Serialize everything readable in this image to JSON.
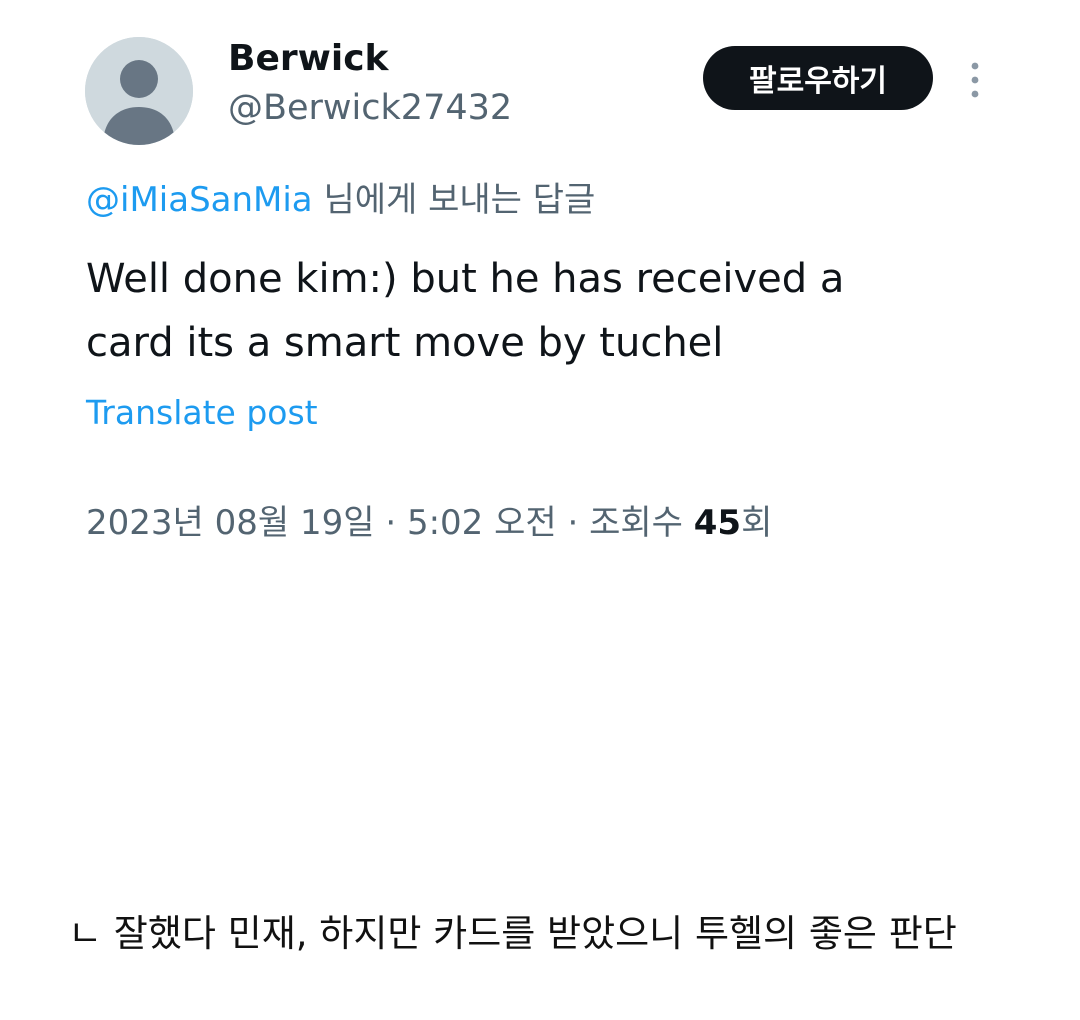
{
  "user": {
    "display_name": "Berwick",
    "handle": "@Berwick27432"
  },
  "follow_button": {
    "label": "팔로우하기"
  },
  "more_menu": {
    "icon": "more-vertical-icon"
  },
  "reply_context": {
    "mention": "@iMiaSanMia",
    "suffix": " 님에게 보내는 답글"
  },
  "tweet": {
    "text_line1": "Well done kim:) but he has received a",
    "text_line2": "card its a smart move by tuchel",
    "translate_label": "Translate post"
  },
  "meta": {
    "date": "2023년 08월 19일",
    "separator": " · ",
    "time": "5:02 오전",
    "views_label": "조회수 ",
    "views_count": "45",
    "views_suffix": "회"
  },
  "caption": {
    "text": "ㄴ 잘했다 민재, 하지만 카드를 받았으니 투헬의 좋은 판단"
  },
  "colors": {
    "accent": "#1d9bf0",
    "text_primary": "#0f1419",
    "text_secondary": "#536471",
    "avatar_bg": "#cfd9de",
    "button_bg": "#0f1419"
  }
}
